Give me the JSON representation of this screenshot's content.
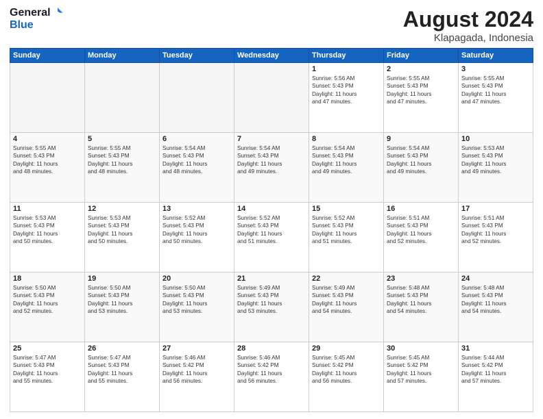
{
  "header": {
    "logo_line1": "General",
    "logo_line2": "Blue",
    "month": "August 2024",
    "location": "Klapagada, Indonesia"
  },
  "weekdays": [
    "Sunday",
    "Monday",
    "Tuesday",
    "Wednesday",
    "Thursday",
    "Friday",
    "Saturday"
  ],
  "weeks": [
    [
      {
        "day": "",
        "info": ""
      },
      {
        "day": "",
        "info": ""
      },
      {
        "day": "",
        "info": ""
      },
      {
        "day": "",
        "info": ""
      },
      {
        "day": "1",
        "info": "Sunrise: 5:56 AM\nSunset: 5:43 PM\nDaylight: 11 hours\nand 47 minutes."
      },
      {
        "day": "2",
        "info": "Sunrise: 5:55 AM\nSunset: 5:43 PM\nDaylight: 11 hours\nand 47 minutes."
      },
      {
        "day": "3",
        "info": "Sunrise: 5:55 AM\nSunset: 5:43 PM\nDaylight: 11 hours\nand 47 minutes."
      }
    ],
    [
      {
        "day": "4",
        "info": "Sunrise: 5:55 AM\nSunset: 5:43 PM\nDaylight: 11 hours\nand 48 minutes."
      },
      {
        "day": "5",
        "info": "Sunrise: 5:55 AM\nSunset: 5:43 PM\nDaylight: 11 hours\nand 48 minutes."
      },
      {
        "day": "6",
        "info": "Sunrise: 5:54 AM\nSunset: 5:43 PM\nDaylight: 11 hours\nand 48 minutes."
      },
      {
        "day": "7",
        "info": "Sunrise: 5:54 AM\nSunset: 5:43 PM\nDaylight: 11 hours\nand 49 minutes."
      },
      {
        "day": "8",
        "info": "Sunrise: 5:54 AM\nSunset: 5:43 PM\nDaylight: 11 hours\nand 49 minutes."
      },
      {
        "day": "9",
        "info": "Sunrise: 5:54 AM\nSunset: 5:43 PM\nDaylight: 11 hours\nand 49 minutes."
      },
      {
        "day": "10",
        "info": "Sunrise: 5:53 AM\nSunset: 5:43 PM\nDaylight: 11 hours\nand 49 minutes."
      }
    ],
    [
      {
        "day": "11",
        "info": "Sunrise: 5:53 AM\nSunset: 5:43 PM\nDaylight: 11 hours\nand 50 minutes."
      },
      {
        "day": "12",
        "info": "Sunrise: 5:53 AM\nSunset: 5:43 PM\nDaylight: 11 hours\nand 50 minutes."
      },
      {
        "day": "13",
        "info": "Sunrise: 5:52 AM\nSunset: 5:43 PM\nDaylight: 11 hours\nand 50 minutes."
      },
      {
        "day": "14",
        "info": "Sunrise: 5:52 AM\nSunset: 5:43 PM\nDaylight: 11 hours\nand 51 minutes."
      },
      {
        "day": "15",
        "info": "Sunrise: 5:52 AM\nSunset: 5:43 PM\nDaylight: 11 hours\nand 51 minutes."
      },
      {
        "day": "16",
        "info": "Sunrise: 5:51 AM\nSunset: 5:43 PM\nDaylight: 11 hours\nand 52 minutes."
      },
      {
        "day": "17",
        "info": "Sunrise: 5:51 AM\nSunset: 5:43 PM\nDaylight: 11 hours\nand 52 minutes."
      }
    ],
    [
      {
        "day": "18",
        "info": "Sunrise: 5:50 AM\nSunset: 5:43 PM\nDaylight: 11 hours\nand 52 minutes."
      },
      {
        "day": "19",
        "info": "Sunrise: 5:50 AM\nSunset: 5:43 PM\nDaylight: 11 hours\nand 53 minutes."
      },
      {
        "day": "20",
        "info": "Sunrise: 5:50 AM\nSunset: 5:43 PM\nDaylight: 11 hours\nand 53 minutes."
      },
      {
        "day": "21",
        "info": "Sunrise: 5:49 AM\nSunset: 5:43 PM\nDaylight: 11 hours\nand 53 minutes."
      },
      {
        "day": "22",
        "info": "Sunrise: 5:49 AM\nSunset: 5:43 PM\nDaylight: 11 hours\nand 54 minutes."
      },
      {
        "day": "23",
        "info": "Sunrise: 5:48 AM\nSunset: 5:43 PM\nDaylight: 11 hours\nand 54 minutes."
      },
      {
        "day": "24",
        "info": "Sunrise: 5:48 AM\nSunset: 5:43 PM\nDaylight: 11 hours\nand 54 minutes."
      }
    ],
    [
      {
        "day": "25",
        "info": "Sunrise: 5:47 AM\nSunset: 5:43 PM\nDaylight: 11 hours\nand 55 minutes."
      },
      {
        "day": "26",
        "info": "Sunrise: 5:47 AM\nSunset: 5:43 PM\nDaylight: 11 hours\nand 55 minutes."
      },
      {
        "day": "27",
        "info": "Sunrise: 5:46 AM\nSunset: 5:42 PM\nDaylight: 11 hours\nand 56 minutes."
      },
      {
        "day": "28",
        "info": "Sunrise: 5:46 AM\nSunset: 5:42 PM\nDaylight: 11 hours\nand 56 minutes."
      },
      {
        "day": "29",
        "info": "Sunrise: 5:45 AM\nSunset: 5:42 PM\nDaylight: 11 hours\nand 56 minutes."
      },
      {
        "day": "30",
        "info": "Sunrise: 5:45 AM\nSunset: 5:42 PM\nDaylight: 11 hours\nand 57 minutes."
      },
      {
        "day": "31",
        "info": "Sunrise: 5:44 AM\nSunset: 5:42 PM\nDaylight: 11 hours\nand 57 minutes."
      }
    ]
  ]
}
